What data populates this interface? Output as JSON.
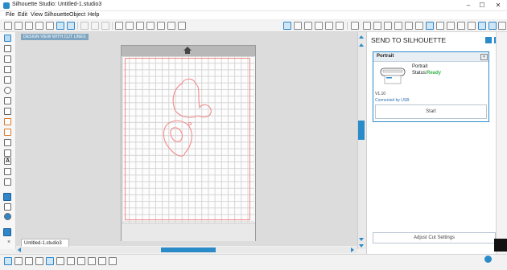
{
  "window": {
    "title": "Silhouette Studio: Untitled-1.studio3",
    "controls": [
      "–",
      "☐",
      "✕"
    ]
  },
  "menu": [
    "File",
    "Edit",
    "View",
    "Silhouette",
    "Object",
    "Help"
  ],
  "canvas": {
    "banner": "DESIGN VIEW WITH CUT LINES",
    "document_tab": "Untitled-1.studio3",
    "tab_close": "×"
  },
  "panel": {
    "title": "SEND TO SILHOUETTE",
    "device": {
      "name": "Portrait",
      "model": "Portrait",
      "status_label": "Status:",
      "status": "Ready",
      "firmware": "V1.10",
      "connected_by": "Connected by USB",
      "start_label": "Start",
      "minimize": "×"
    },
    "adjust_label": "Adjust Cut Settings"
  },
  "colors": {
    "accent": "#2a8bc9",
    "cut_line": "#f28b8b",
    "status_ready": "#3bb34a"
  }
}
